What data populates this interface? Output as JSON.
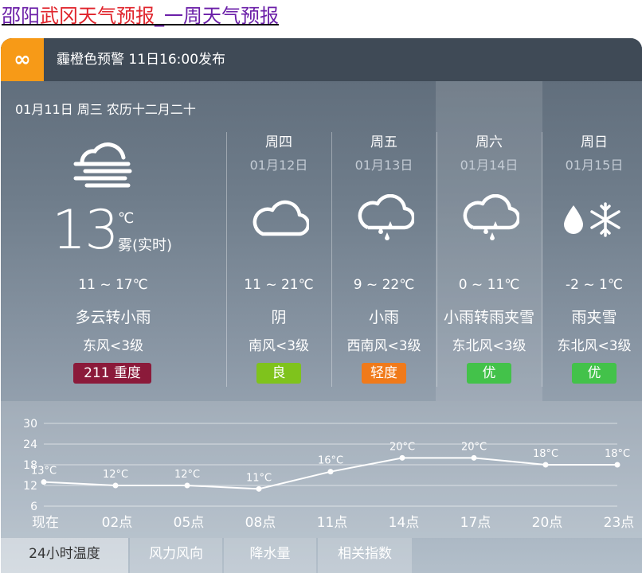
{
  "page_title": {
    "part1": "邵阳",
    "part2": "武冈天气预报",
    "part3": "_一周天气预报"
  },
  "alert": {
    "icon": "infinity-icon",
    "text": "霾橙色预警 11日16:00发布",
    "icon_color": "#f79a17"
  },
  "date_line": "01月11日 周三 农历十二月二十",
  "today": {
    "icon": "fog-cloud-icon",
    "temp": "13",
    "unit": "℃",
    "realtime": "雾(实时)",
    "range": "11 ~ 17℃",
    "desc": "多云转小雨",
    "wind": "东风<3级",
    "aqi": "211 重度",
    "aqi_color": "#8b1a3a"
  },
  "days": [
    {
      "name": "周四",
      "date": "01月12日",
      "icon": "cloud-icon",
      "range": "11 ~ 21℃",
      "desc": "阴",
      "wind": "南风<3级",
      "aqi": "良",
      "aqi_color": "#7fc31c"
    },
    {
      "name": "周五",
      "date": "01月13日",
      "icon": "rain-cloud-icon",
      "range": "9 ~ 22℃",
      "desc": "小雨",
      "wind": "西南风<3级",
      "aqi": "轻度",
      "aqi_color": "#f07a1a"
    },
    {
      "name": "周六",
      "date": "01月14日",
      "icon": "rain-cloud-icon",
      "range": "0 ~ 11℃",
      "desc": "小雨转雨夹雪",
      "wind": "东北风<3级",
      "aqi": "优",
      "aqi_color": "#43c24a"
    },
    {
      "name": "周日",
      "date": "01月15日",
      "icon": "sleet-icon",
      "range": "-2 ~ 1℃",
      "desc": "雨夹雪",
      "wind": "东北风<3级",
      "aqi": "优",
      "aqi_color": "#43c24a"
    }
  ],
  "chart_data": {
    "type": "line",
    "categories": [
      "现在",
      "02点",
      "05点",
      "08点",
      "11点",
      "14点",
      "17点",
      "20点",
      "23点"
    ],
    "values": [
      13,
      12,
      12,
      11,
      16,
      20,
      20,
      18,
      18
    ],
    "labels": [
      "13°C",
      "12°C",
      "12°C",
      "11°C",
      "16°C",
      "20°C",
      "20°C",
      "18°C",
      "18°C"
    ],
    "yticks": [
      "30",
      "24",
      "18",
      "12",
      "6"
    ],
    "ylim": [
      6,
      30
    ],
    "grid": true
  },
  "tabs": [
    "24小时温度",
    "风力风向",
    "降水量",
    "相关指数"
  ]
}
